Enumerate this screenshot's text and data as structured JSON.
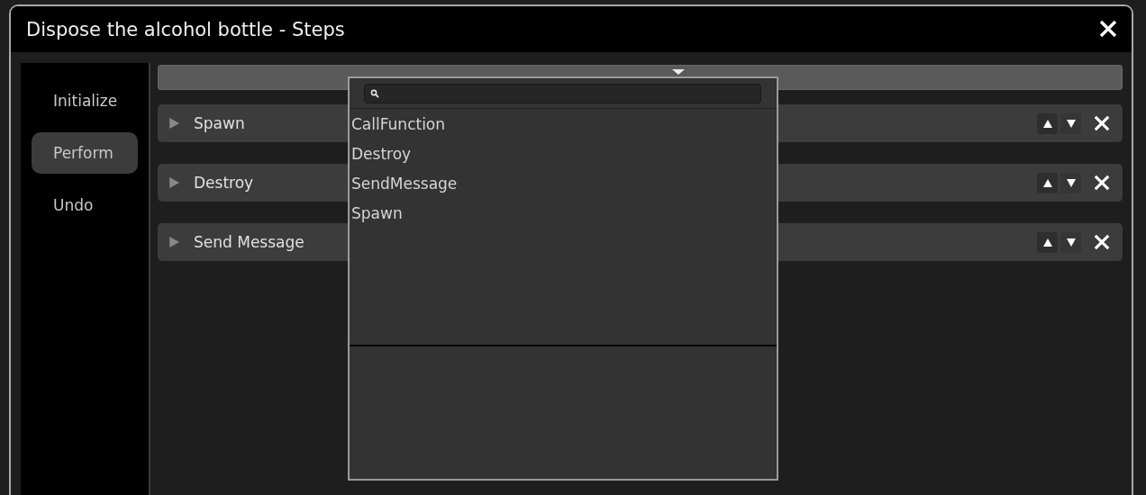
{
  "window": {
    "title": "Dispose the alcohol bottle - Steps"
  },
  "sidebar": {
    "items": [
      {
        "label": "Initialize",
        "selected": false
      },
      {
        "label": "Perform",
        "selected": true
      },
      {
        "label": "Undo",
        "selected": false
      }
    ]
  },
  "steps": [
    {
      "label": "Spawn",
      "expanded": false
    },
    {
      "label": "Destroy",
      "expanded": false
    },
    {
      "label": "Send Message",
      "expanded": false
    }
  ],
  "dropdown": {
    "items": [
      "CallFunction",
      "Destroy",
      "SendMessage",
      "Spawn"
    ]
  }
}
